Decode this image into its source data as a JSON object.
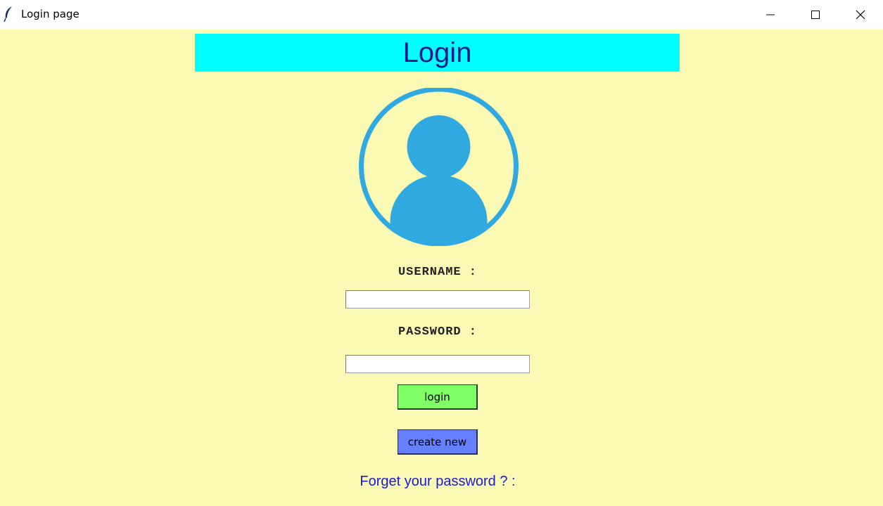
{
  "window": {
    "title": "Login page",
    "controls": [
      "minimize-icon",
      "maximize-icon",
      "close-icon"
    ]
  },
  "header": {
    "title": "Login",
    "background": "#00ffff",
    "color": "#1a1a8c"
  },
  "avatar": {
    "icon": "user-avatar-icon",
    "color": "#30a8e0"
  },
  "form": {
    "username_label": "USERNAME :",
    "username_value": "",
    "password_label": "PASSWORD :",
    "password_value": ""
  },
  "buttons": {
    "login_label": "login",
    "login_color": "#80ff66",
    "create_label": "create new",
    "create_color": "#6680ff"
  },
  "links": {
    "forgot_password": "Forget your password ? :"
  },
  "theme": {
    "background": "#fafab5"
  }
}
